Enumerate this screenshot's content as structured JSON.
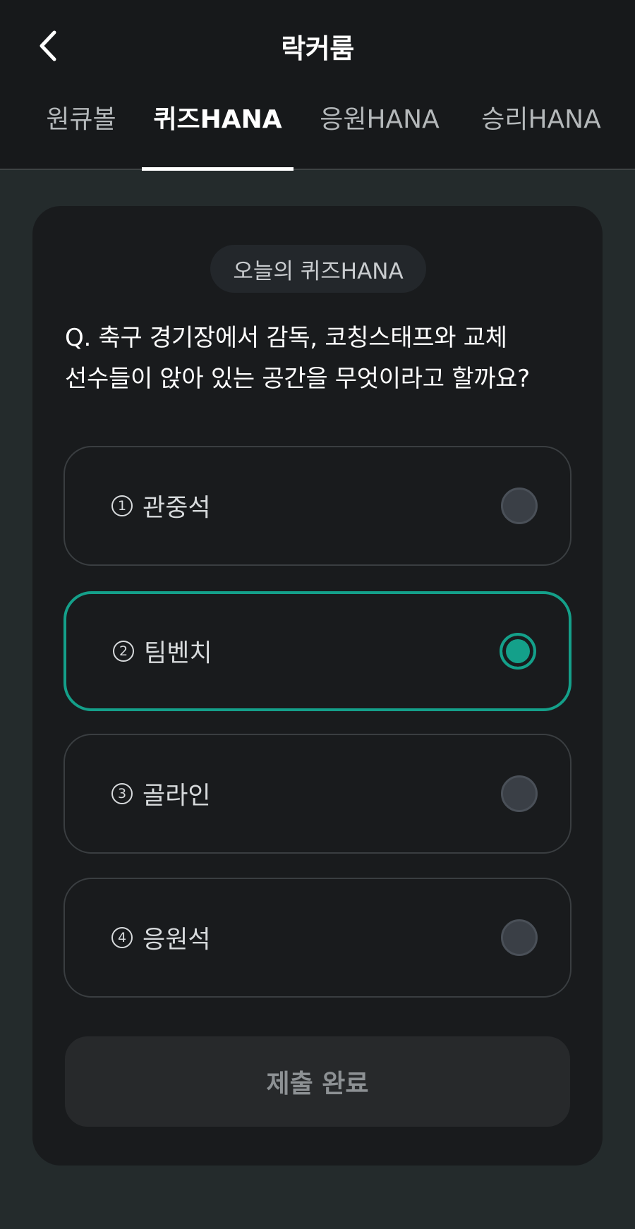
{
  "header": {
    "title": "락커룸",
    "back_icon": "chevron-left-icon"
  },
  "tabs": [
    {
      "label": "원큐볼",
      "active": false
    },
    {
      "label": "퀴즈HANA",
      "active": true
    },
    {
      "label": "응원HANA",
      "active": false
    },
    {
      "label": "승리HANA",
      "active": false
    }
  ],
  "quiz": {
    "chip": "오늘의 퀴즈HANA",
    "question_line1": "Q. 축구 경기장에서 감독, 코칭스태프와 교체",
    "question_line2": "선수들이 앉아 있는 공간을 무엇이라고 할까요?",
    "options": [
      {
        "number": "1",
        "label": "관중석",
        "selected": false
      },
      {
        "number": "2",
        "label": "팀벤치",
        "selected": true
      },
      {
        "number": "3",
        "label": "골라인",
        "selected": false
      },
      {
        "number": "4",
        "label": "응원석",
        "selected": false
      }
    ],
    "submit_label": "제출 완료"
  },
  "colors": {
    "accent": "#14a08a",
    "background": "#242b2c",
    "header": "#17191b",
    "card": "#191b1d"
  }
}
